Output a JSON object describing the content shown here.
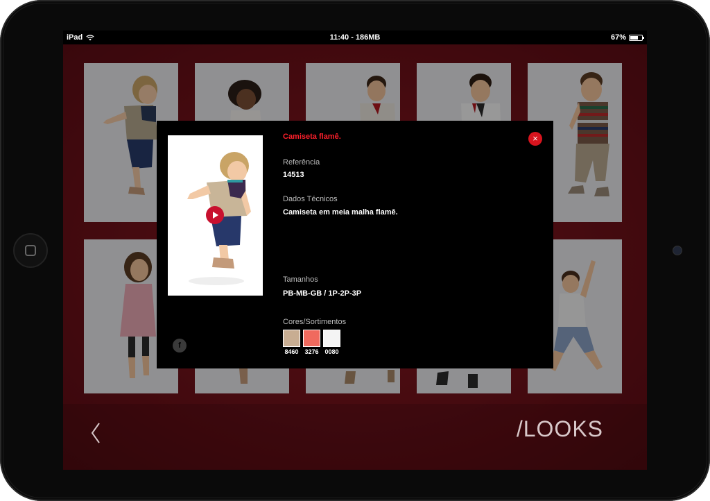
{
  "statusbar": {
    "device": "iPad",
    "time_memory": "11:40 - 186MB",
    "battery_percent": "67%",
    "battery_level": 0.67
  },
  "app": {
    "section_title": "/LOOKS",
    "back_icon": "chevron-left-icon"
  },
  "product": {
    "name": "Camiseta flamê.",
    "reference_label": "Referência",
    "reference": "14513",
    "tech_label": "Dados Técnicos",
    "tech": "Camiseta em meia malha flamê.",
    "sizes_label": "Tamanhos",
    "sizes": "PB-MB-GB / 1P-2P-3P",
    "colors_label": "Cores/Sortimentos",
    "colors": [
      {
        "code": "8460",
        "hex": "#c8ad92"
      },
      {
        "code": "3276",
        "hex": "#f06a5e"
      },
      {
        "code": "0080",
        "hex": "#f4f4f4"
      }
    ],
    "close_icon": "close-icon",
    "play_icon": "play-icon",
    "share_icon": "facebook-icon",
    "share_label": "f",
    "close_label": "×"
  },
  "colors": {
    "accent_red": "#d8141e",
    "title_red": "#ff1f2b",
    "background_red": "#7a1520"
  }
}
